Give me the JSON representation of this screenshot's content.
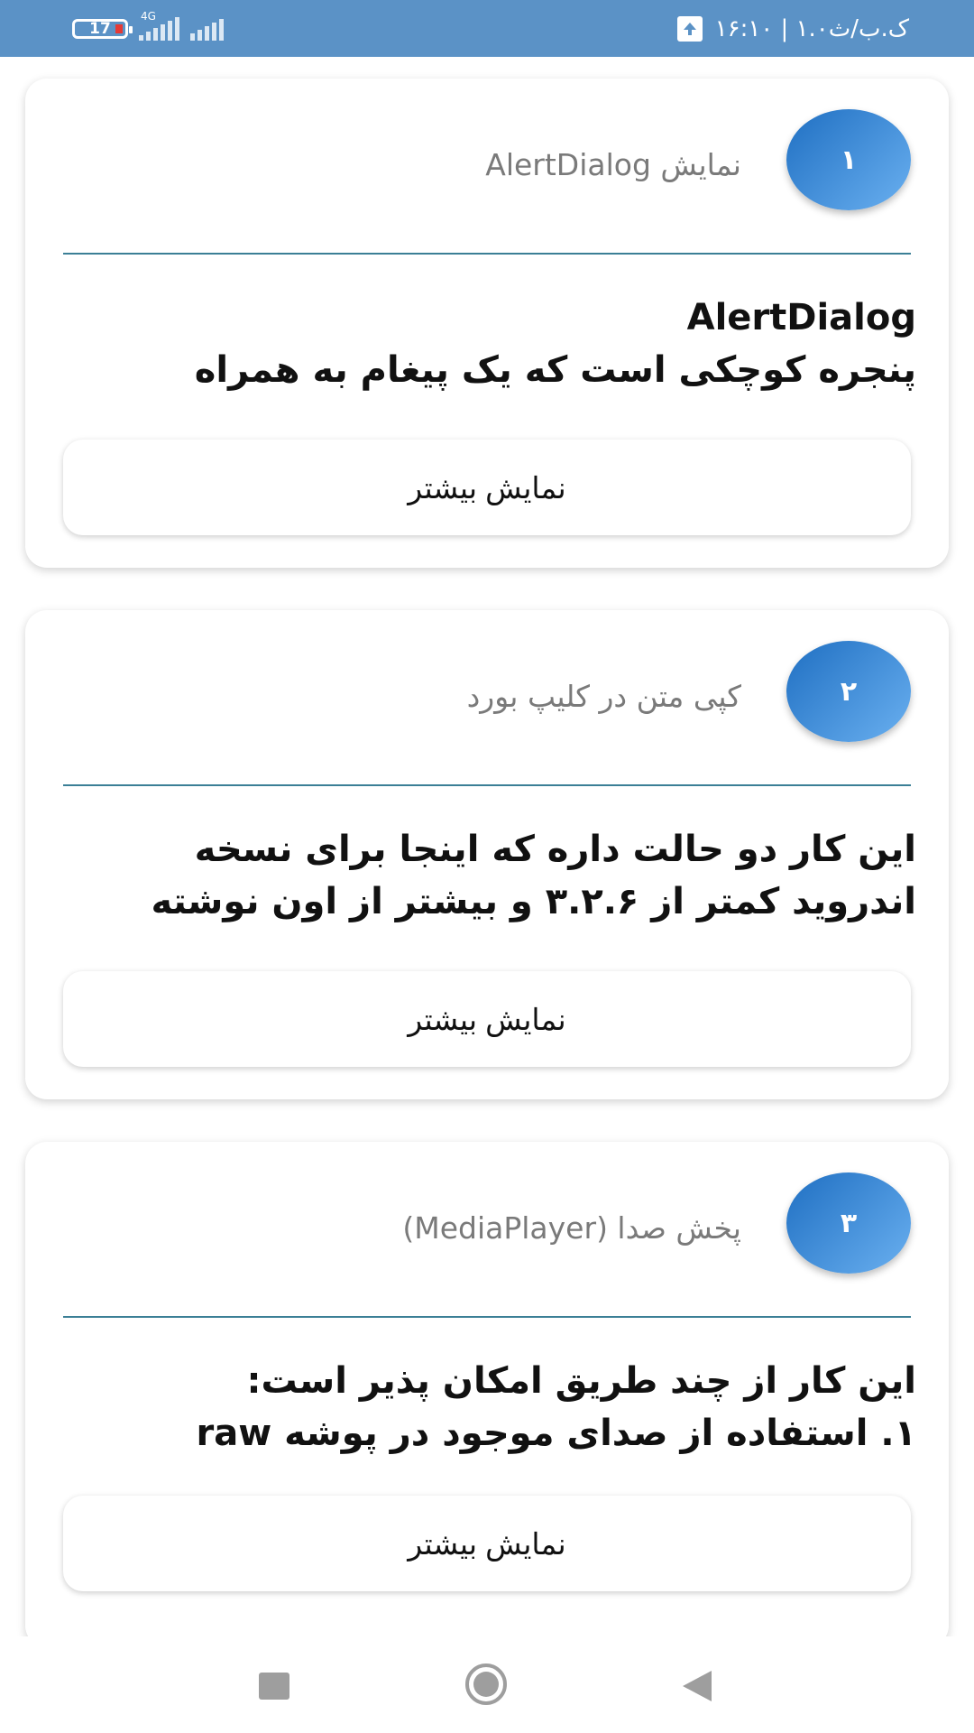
{
  "status_bar": {
    "time_date": "۱۶:۱۰ | ۱.ک.ب/ث۰",
    "battery": "17",
    "network": "4G"
  },
  "cards": [
    {
      "number": "۱",
      "title": "نمایش AlertDialog",
      "body": "AlertDialog\nپنجره کوچکی است که یک پیغام به همراه",
      "button": "نمایش بیشتر"
    },
    {
      "number": "۲",
      "title": "کپی متن در کلیپ بورد",
      "body": "این کار دو حالت داره که اینجا برای نسخه\nاندروید کمتر از ۳.۲.۶ و بیشتر از اون نوشته",
      "button": "نمایش بیشتر"
    },
    {
      "number": "۳",
      "title": "پخش صدا (MediaPlayer)",
      "body": "این کار از چند طریق امکان پذیر است:\n۱. استفاده از صدای موجود در پوشه raw",
      "button": "نمایش بیشتر"
    }
  ],
  "colors": {
    "status_bar": "#5b92c6",
    "badge_start": "#1f6fc2",
    "badge_end": "#6ab0f0",
    "divider": "#3b7f96"
  },
  "nav": {
    "icons": [
      "recents-square-icon",
      "home-circle-icon",
      "back-triangle-icon"
    ]
  }
}
